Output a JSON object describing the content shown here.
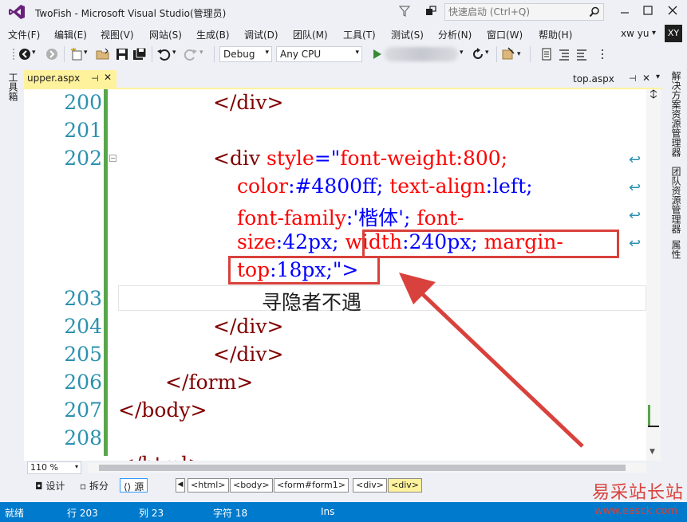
{
  "window": {
    "title": "TwoFish - Microsoft Visual Studio(管理员)",
    "quick_launch_placeholder": "快速启动 (Ctrl+Q)",
    "user_name": "xw yu",
    "user_initials": "XY"
  },
  "menu": [
    "文件(F)",
    "编辑(E)",
    "视图(V)",
    "网站(S)",
    "生成(B)",
    "调试(D)",
    "团队(M)",
    "工具(T)",
    "测试(S)",
    "分析(N)",
    "窗口(W)",
    "帮助(H)"
  ],
  "toolbar": {
    "configuration": "Debug",
    "platform": "Any CPU"
  },
  "left_strip": {
    "toolbox": "工具箱"
  },
  "right_strip": [
    "解决方案资源管理器",
    "团队资源管理器",
    "属性"
  ],
  "tabs": {
    "active": "upper.aspx",
    "right": "top.aspx"
  },
  "editor": {
    "line_numbers": [
      "200",
      "201",
      "202",
      "203",
      "204",
      "205",
      "206",
      "207",
      "208"
    ],
    "lines": {
      "l200": "</div>",
      "l202a_tag": "<div ",
      "l202a_attr": "style",
      "l202a_eq": "=\"",
      "l202a_val": "font-weight:800;",
      "l202b_attr1": "color",
      "l202b_val1": ":#4800ff;",
      "l202b_attr2": " text-align",
      "l202b_val2": ":left;",
      "l202c_attr1": "font-family",
      "l202c_val1": ":'楷体';",
      "l202c_attr2": " font-",
      "l202d_attr1": "size",
      "l202d_val1": ":42px;",
      "l202d_attr2": "width",
      "l202d_val2": ":240px;",
      "l202d_attr3": " margin-",
      "l202e_attr1": "top",
      "l202e_val1": ":18px;",
      "l202e_close": "\">",
      "l203": "寻隐者不遇",
      "l204": "</div>",
      "l205": "</div>",
      "l206": "</form>",
      "l207": "</body>",
      "l209": "</html>"
    }
  },
  "zoom": "110 %",
  "views": {
    "design": "设计",
    "split": "拆分",
    "source": "源"
  },
  "breadcrumbs": [
    "<html>",
    "<body>",
    "<form#form1>",
    "<div>",
    "<div>"
  ],
  "status": {
    "state": "就绪",
    "line": "行 203",
    "col": "列 23",
    "char": "字符 18",
    "mode": "Ins"
  },
  "watermark": {
    "name": "易采站长站",
    "url": "www.easck.com"
  }
}
